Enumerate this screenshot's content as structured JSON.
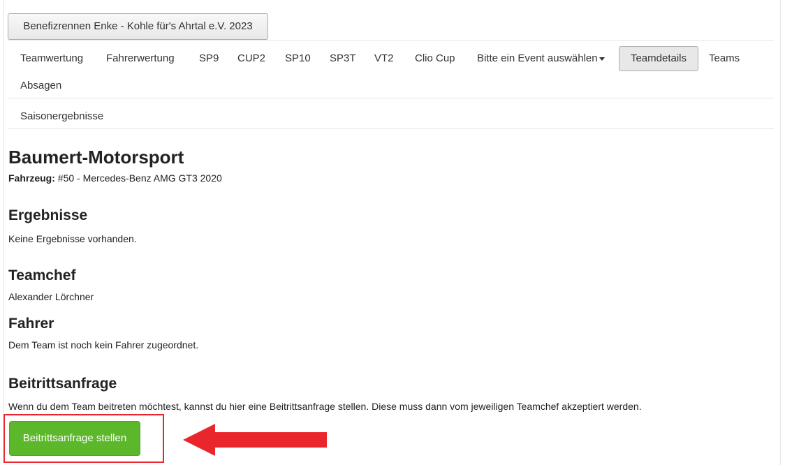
{
  "event_button": "Benefizrennen Enke - Kohle für's Ahrtal e.V. 2023",
  "nav": {
    "items": [
      "Teamwertung",
      "Fahrerwertung",
      "SP9",
      "CUP2",
      "SP10",
      "SP3T",
      "VT2",
      "Clio Cup"
    ],
    "event_dropdown": "Bitte ein Event auswählen",
    "active": "Teamdetails",
    "teams": "Teams",
    "absagen": "Absagen",
    "saison": "Saisonergebnisse"
  },
  "team": {
    "name": "Baumert-Motorsport",
    "vehicle_label": "Fahrzeug:",
    "vehicle_value": "#50 - Mercedes-Benz AMG GT3 2020"
  },
  "sections": {
    "results_title": "Ergebnisse",
    "results_text": "Keine Ergebnisse vorhanden.",
    "chief_title": "Teamchef",
    "chief_name": "Alexander Lörchner",
    "drivers_title": "Fahrer",
    "drivers_text": "Dem Team ist noch kein Fahrer zugeordnet.",
    "join_title": "Beitrittsanfrage",
    "join_text": "Wenn du dem Team beitreten möchtest, kannst du hier eine Beitrittsanfrage stellen. Diese muss dann vom jeweiligen Teamchef akzeptiert werden.",
    "join_button": "Beitrittsanfrage stellen"
  },
  "annotation_color": "#e8262c",
  "button_color": "#5cb82a"
}
